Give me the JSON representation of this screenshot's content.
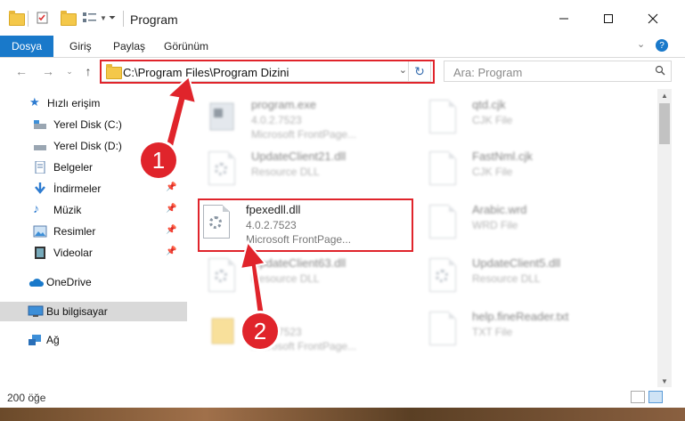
{
  "window": {
    "title": "Program"
  },
  "ribbon": {
    "tabs": [
      "Dosya",
      "Giriş",
      "Paylaş",
      "Görünüm"
    ]
  },
  "address": {
    "path": "C:\\Program Files\\Program Dizini"
  },
  "search": {
    "placeholder": "Ara: Program"
  },
  "sidebar": {
    "items": [
      {
        "label": "Hızlı erişim",
        "icon": "star-icon"
      },
      {
        "label": "Yerel Disk (C:)",
        "icon": "drive-icon"
      },
      {
        "label": "Yerel Disk (D:)",
        "icon": "drive-icon"
      },
      {
        "label": "Belgeler",
        "icon": "documents-icon"
      },
      {
        "label": "İndirmeler",
        "icon": "download-icon"
      },
      {
        "label": "Müzik",
        "icon": "music-icon"
      },
      {
        "label": "Resimler",
        "icon": "pictures-icon"
      },
      {
        "label": "Videolar",
        "icon": "video-icon"
      },
      {
        "label": "OneDrive",
        "icon": "cloud-icon"
      },
      {
        "label": "Bu bilgisayar",
        "icon": "computer-icon"
      },
      {
        "label": "Ağ",
        "icon": "network-icon"
      }
    ]
  },
  "files": [
    {
      "name": "program.exe",
      "line2": "4.0.2.7523",
      "line3": "Microsoft FrontPage..."
    },
    {
      "name": "qtd.cjk",
      "line2": "CJK File",
      "line3": ""
    },
    {
      "name": "UpdateClient21.dll",
      "line2": "Resource DLL",
      "line3": ""
    },
    {
      "name": "FastNml.cjk",
      "line2": "CJK File",
      "line3": ""
    },
    {
      "name": "fpexedll.dll",
      "line2": "4.0.2.7523",
      "line3": "Microsoft FrontPage..."
    },
    {
      "name": "Arabic.wrd",
      "line2": "WRD File",
      "line3": ""
    },
    {
      "name": "UpdateClient63.dll",
      "line2": "Resource DLL",
      "line3": ""
    },
    {
      "name": "UpdateClient5.dll",
      "line2": "Resource DLL",
      "line3": ""
    },
    {
      "name": "",
      "line2": "4.0.2.7523",
      "line3": "Microsoft FrontPage..."
    },
    {
      "name": "help.fineReader.txt",
      "line2": "TXT File",
      "line3": ""
    }
  ],
  "status": {
    "item_count": "200 öğe"
  },
  "annotations": {
    "step1": "1",
    "step2": "2",
    "accent": "#e0242b"
  }
}
